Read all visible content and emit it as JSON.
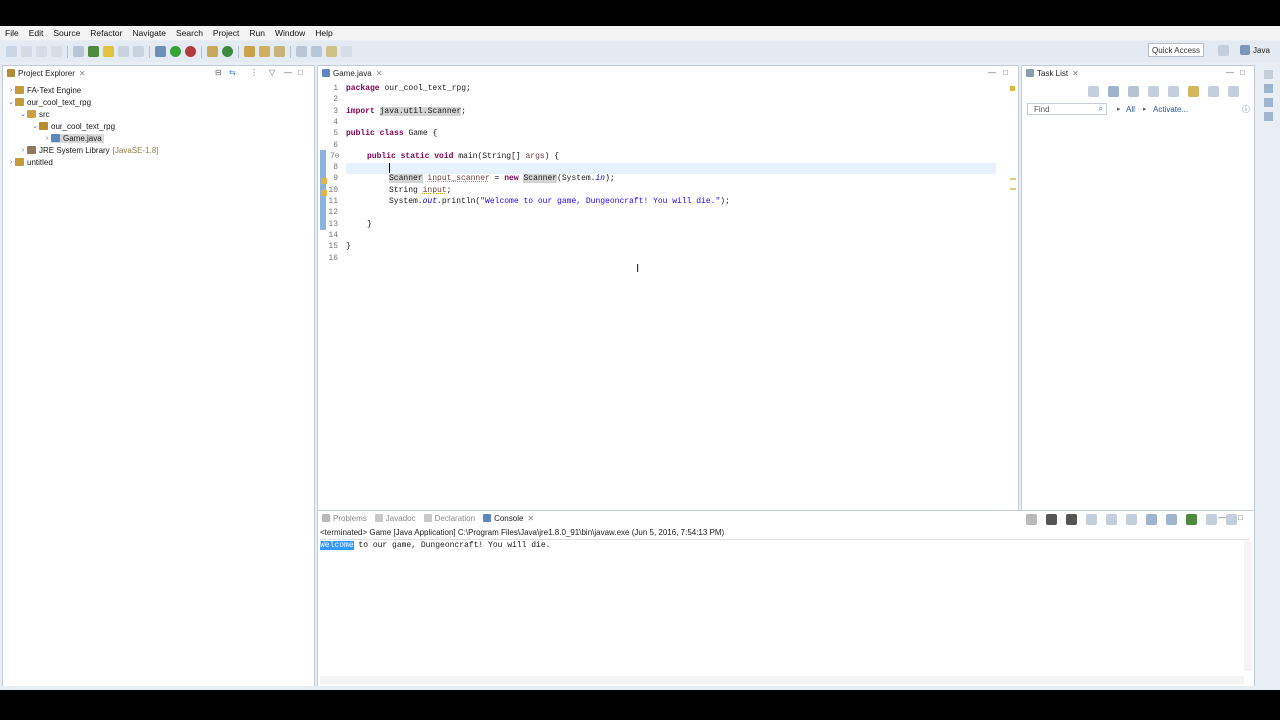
{
  "menu": [
    "File",
    "Edit",
    "Source",
    "Refactor",
    "Navigate",
    "Search",
    "Project",
    "Run",
    "Window",
    "Help"
  ],
  "quick_access": "Quick Access",
  "perspective": "Java",
  "project_explorer": {
    "title": "Project Explorer",
    "items": [
      {
        "label": "FA-Text Engine",
        "depth": 0,
        "expanded": false
      },
      {
        "label": "our_cool_text_rpg",
        "depth": 0,
        "expanded": true
      },
      {
        "label": "src",
        "depth": 1,
        "expanded": true
      },
      {
        "label": "our_cool_text_rpg",
        "depth": 2,
        "expanded": true
      },
      {
        "label": "Game.java",
        "depth": 3,
        "expanded": false
      },
      {
        "label": "JRE System Library",
        "suffix": "[JavaSE-1.8]",
        "depth": 1,
        "expanded": false
      },
      {
        "label": "untitled",
        "depth": 0,
        "expanded": false
      }
    ]
  },
  "editor": {
    "tab_label": "Game.java",
    "line_numbers": [
      "1",
      "2",
      "3",
      "4",
      "5",
      "6",
      "7⊖",
      "8",
      "9",
      "10",
      "11",
      "12",
      "13",
      "14",
      "15",
      "16"
    ],
    "lines": {
      "l1_kw": "package",
      "l1_rest": " our_cool_text_rpg;",
      "l3_kw": "import",
      "l3_rest": "java.util.Scanner",
      "l5_kw1": "public",
      "l5_kw2": "class",
      "l5_rest": " Game {",
      "l7_kw1": "public",
      "l7_kw2": "static",
      "l7_kw3": "void",
      "l7_rest": " main(String[] ",
      "l7_args": "args",
      "l7_end": ") {",
      "l9_type": "Scanner",
      "l9_var": "input_scanner",
      "l9_mid": " = ",
      "l9_new": "new",
      "l9_type2": "Scanner",
      "l9_end1": "(System.",
      "l9_in": "in",
      "l9_end2": ");",
      "l10_a": "String ",
      "l10_var": "input",
      "l10_b": ";",
      "l11_a": "System.",
      "l11_out": "out",
      "l11_b": ".println(",
      "l11_str": "\"Welcome to our game, Dungeoncraft! You will die.\"",
      "l11_c": ");",
      "l13": "}",
      "l15": "}"
    }
  },
  "task_list": {
    "title": "Task List",
    "find_placeholder": "Find",
    "all_label": "All",
    "activate_label": "Activate..."
  },
  "bottom_tabs": [
    "Problems",
    "Javadoc",
    "Declaration",
    "Console"
  ],
  "console": {
    "status": "<terminated> Game [Java Application] C:\\Program Files\\Java\\jre1.8.0_91\\bin\\javaw.exe (Jun 5, 2016, 7:54:13 PM)",
    "output_selected": "Welcome",
    "output_rest": " to our game, Dungeoncraft! You will die."
  },
  "colors": {
    "keyword": "#7f0055",
    "string": "#2a00ff",
    "selection": "#3399ff",
    "chrome": "#e9eef5"
  }
}
